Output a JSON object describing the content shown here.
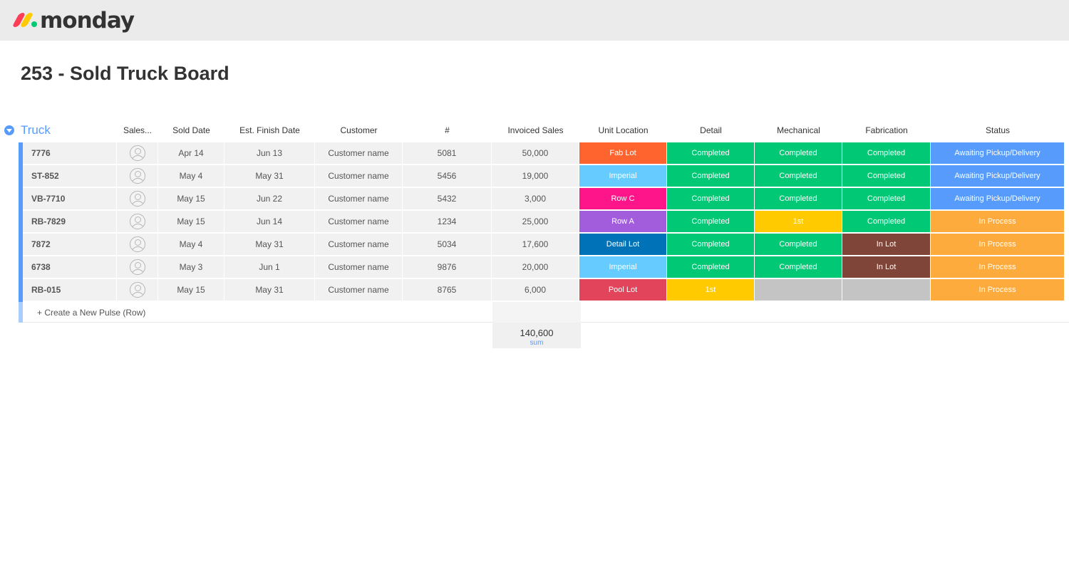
{
  "app": {
    "logo_text": "monday",
    "brand_colors": {
      "red": "#ff3d57",
      "yellow": "#ffcb00",
      "green": "#00ca72"
    }
  },
  "board": {
    "title": "253 - Sold Truck Board"
  },
  "group": {
    "title": "Truck",
    "color": "#579bfc"
  },
  "columns": [
    "Sales...",
    "Sold Date",
    "Est. Finish Date",
    "Customer",
    "#",
    "Invoiced Sales",
    "Unit Location",
    "Detail",
    "Mechanical",
    "Fabrication",
    "Status"
  ],
  "rows": [
    {
      "name": "7776",
      "sold_date": "Apr 14",
      "finish_date": "Jun 13",
      "customer": "Customer name",
      "num": "5081",
      "invoiced": "50,000",
      "unit_location": {
        "label": "Fab Lot",
        "color": "#ff642e"
      },
      "detail": {
        "label": "Completed",
        "color": "#00c875"
      },
      "mechanical": {
        "label": "Completed",
        "color": "#00c875"
      },
      "fabrication": {
        "label": "Completed",
        "color": "#00c875"
      },
      "status": {
        "label": "Awaiting Pickup/Delivery",
        "color": "#579bfc"
      }
    },
    {
      "name": "ST-852",
      "sold_date": "May 4",
      "finish_date": "May 31",
      "customer": "Customer name",
      "num": "5456",
      "invoiced": "19,000",
      "unit_location": {
        "label": "Imperial",
        "color": "#66ccff"
      },
      "detail": {
        "label": "Completed",
        "color": "#00c875"
      },
      "mechanical": {
        "label": "Completed",
        "color": "#00c875"
      },
      "fabrication": {
        "label": "Completed",
        "color": "#00c875"
      },
      "status": {
        "label": "Awaiting Pickup/Delivery",
        "color": "#579bfc"
      }
    },
    {
      "name": "VB-7710",
      "sold_date": "May 15",
      "finish_date": "Jun 22",
      "customer": "Customer name",
      "num": "5432",
      "invoiced": "3,000",
      "unit_location": {
        "label": "Row C",
        "color": "#ff158a"
      },
      "detail": {
        "label": "Completed",
        "color": "#00c875"
      },
      "mechanical": {
        "label": "Completed",
        "color": "#00c875"
      },
      "fabrication": {
        "label": "Completed",
        "color": "#00c875"
      },
      "status": {
        "label": "Awaiting Pickup/Delivery",
        "color": "#579bfc"
      }
    },
    {
      "name": "RB-7829",
      "sold_date": "May 15",
      "finish_date": "Jun 14",
      "customer": "Customer name",
      "num": "1234",
      "invoiced": "25,000",
      "unit_location": {
        "label": "Row A",
        "color": "#a25ddc"
      },
      "detail": {
        "label": "Completed",
        "color": "#00c875"
      },
      "mechanical": {
        "label": "1st",
        "color": "#ffcb00"
      },
      "fabrication": {
        "label": "Completed",
        "color": "#00c875"
      },
      "status": {
        "label": "In Process",
        "color": "#fdab3d"
      }
    },
    {
      "name": "7872",
      "sold_date": "May 4",
      "finish_date": "May 31",
      "customer": "Customer name",
      "num": "5034",
      "invoiced": "17,600",
      "unit_location": {
        "label": "Detail Lot",
        "color": "#0073b8"
      },
      "detail": {
        "label": "Completed",
        "color": "#00c875"
      },
      "mechanical": {
        "label": "Completed",
        "color": "#00c875"
      },
      "fabrication": {
        "label": "In Lot",
        "color": "#7f4538"
      },
      "status": {
        "label": "In Process",
        "color": "#fdab3d"
      }
    },
    {
      "name": "6738",
      "sold_date": "May 3",
      "finish_date": "Jun 1",
      "customer": "Customer name",
      "num": "9876",
      "invoiced": "20,000",
      "unit_location": {
        "label": "Imperial",
        "color": "#66ccff"
      },
      "detail": {
        "label": "Completed",
        "color": "#00c875"
      },
      "mechanical": {
        "label": "Completed",
        "color": "#00c875"
      },
      "fabrication": {
        "label": "In Lot",
        "color": "#7f4538"
      },
      "status": {
        "label": "In Process",
        "color": "#fdab3d"
      }
    },
    {
      "name": "RB-015",
      "sold_date": "May 15",
      "finish_date": "May 31",
      "customer": "Customer name",
      "num": "8765",
      "invoiced": "6,000",
      "unit_location": {
        "label": "Pool Lot",
        "color": "#e2445c"
      },
      "detail": {
        "label": "1st",
        "color": "#ffcb00"
      },
      "mechanical": {
        "label": "",
        "color": "#c4c4c4"
      },
      "fabrication": {
        "label": "",
        "color": "#c4c4c4"
      },
      "status": {
        "label": "In Process",
        "color": "#fdab3d"
      }
    }
  ],
  "new_row_label": "+ Create a New Pulse (Row)",
  "summary": {
    "value": "140,600",
    "label": "sum"
  }
}
